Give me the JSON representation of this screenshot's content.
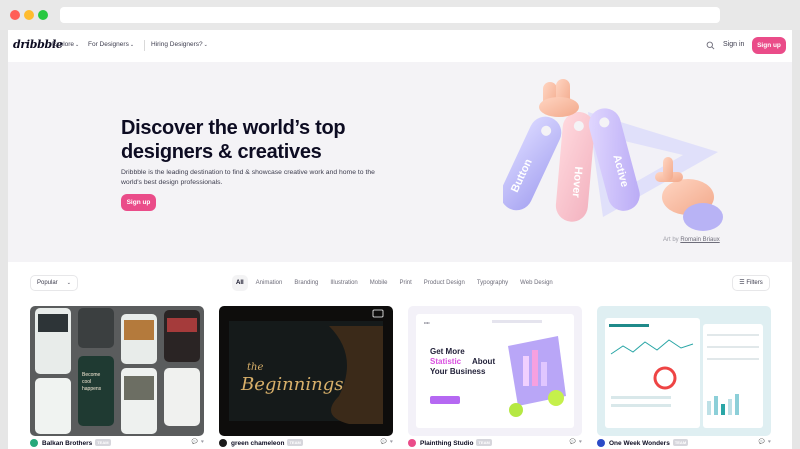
{
  "nav": {
    "logo": "dribbble",
    "explore": "Explore",
    "for_designers": "For Designers",
    "hiring": "Hiring Designers?",
    "sign_in": "Sign in",
    "sign_up": "Sign up"
  },
  "hero": {
    "title": "Discover the world’s top designers & creatives",
    "subtitle": "Dribbble is the leading destination to find & showcase creative work and home to the world's best design professionals.",
    "cta": "Sign up",
    "credit_prefix": "Art by",
    "credit_name": "Romain Briaux",
    "tag_labels": [
      "Button",
      "Hover",
      "Active"
    ]
  },
  "filters": {
    "sort": "Popular",
    "categories": [
      "All",
      "Animation",
      "Branding",
      "Illustration",
      "Mobile",
      "Print",
      "Product Design",
      "Typography",
      "Web Design"
    ],
    "active_category": "All",
    "filters_label": "Filters"
  },
  "shots": [
    {
      "author": "Balkan Brothers",
      "badge": "TEAM",
      "likes": "",
      "views": "",
      "avatar_color": "#27a87a",
      "texts": [
        "Become",
        "cool",
        "happens"
      ]
    },
    {
      "author": "green chameleon",
      "badge": "TEAM",
      "likes": "",
      "views": "",
      "avatar_color": "#1a1a1a",
      "texts": [
        "the",
        "Beginnings"
      ]
    },
    {
      "author": "Plainthing Studio",
      "badge": "TEAM",
      "likes": "",
      "views": "",
      "avatar_color": "#ea4c89",
      "texts": [
        "Get More",
        "Statistic",
        "About",
        "Your Business"
      ]
    },
    {
      "author": "One Week Wonders",
      "badge": "TEAM",
      "likes": "",
      "views": "",
      "avatar_color": "#2c4bc7",
      "texts": []
    }
  ],
  "colors": {
    "brand_pink": "#ea4c89",
    "hero_bg": "#f4f3f6",
    "text_dark": "#0d0c22"
  }
}
